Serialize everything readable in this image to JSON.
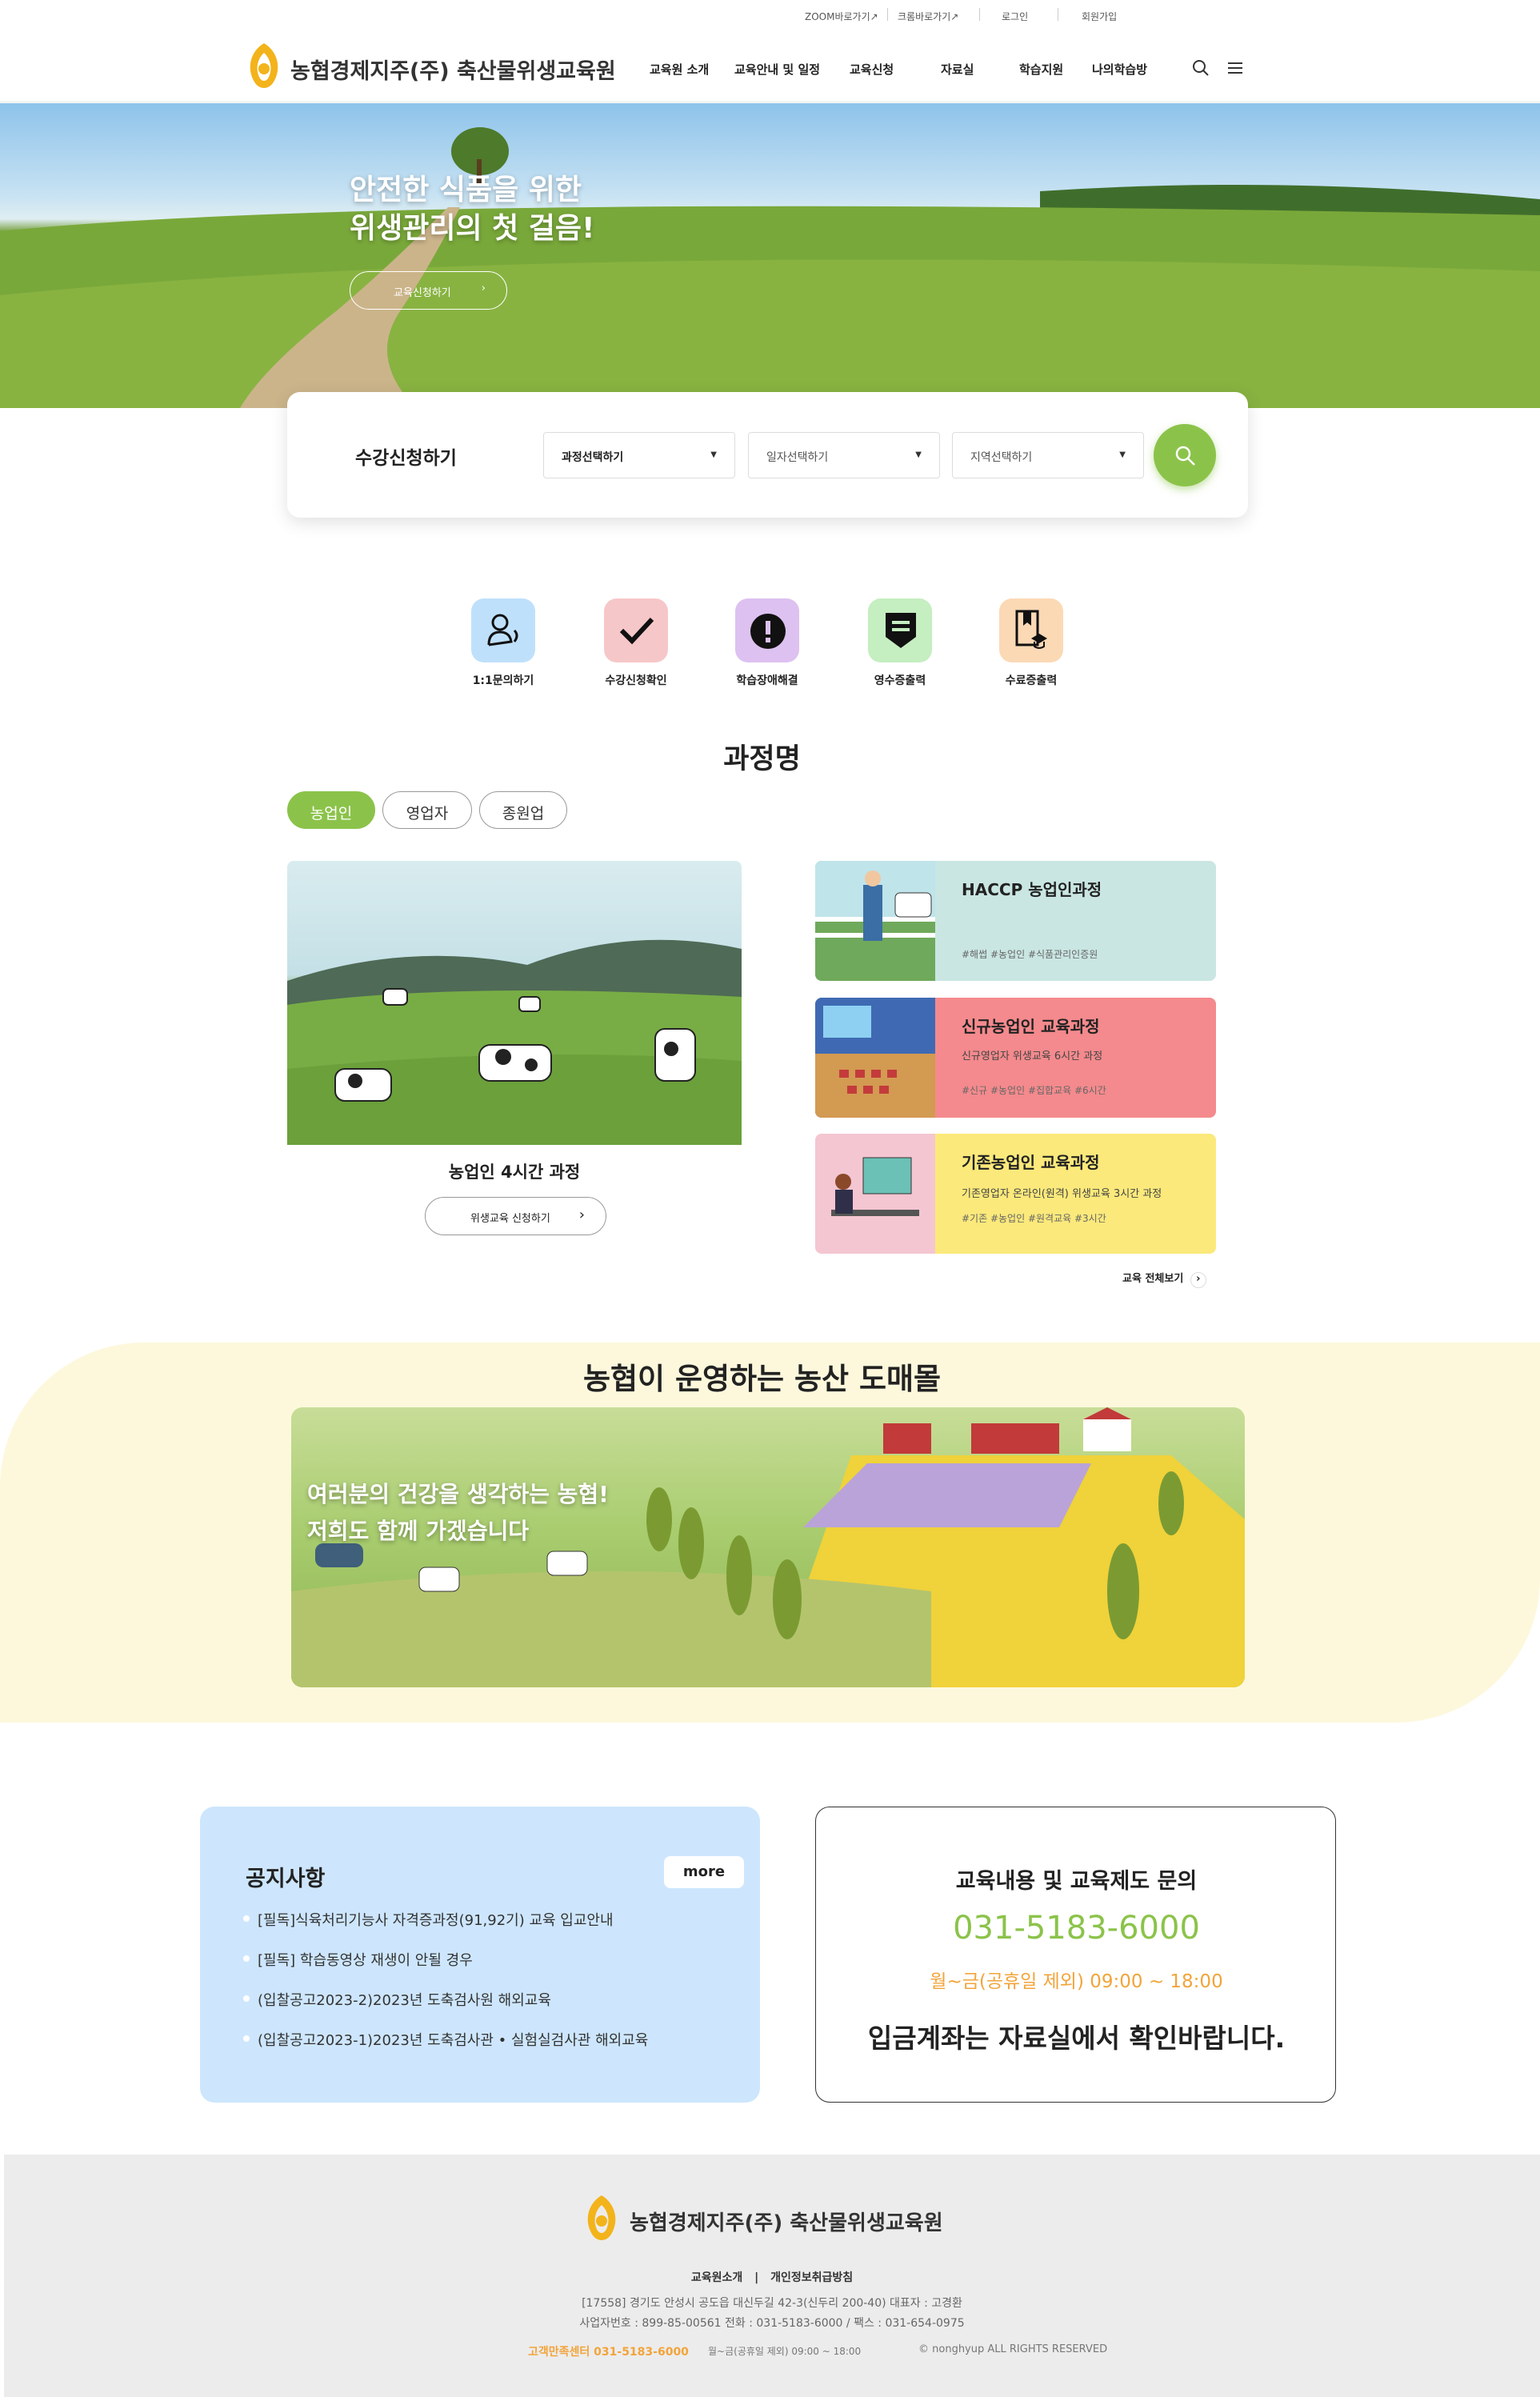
{
  "topbar": {
    "zoom": "ZOOM바로가기↗",
    "chrome": "크롬바로가기↗",
    "login": "로그인",
    "signup": "회원가입"
  },
  "header": {
    "logo_text": "농협경제지주(주) 축산물위생교육원",
    "nav": [
      "교육원 소개",
      "교육안내 및 일정",
      "교육신청",
      "자료실",
      "학습지원",
      "나의학습방"
    ]
  },
  "hero": {
    "line1": "안전한 식품을 위한",
    "line2": "위생관리의 첫 걸음!",
    "button": "교육신청하기"
  },
  "registration": {
    "title": "수강신청하기",
    "course_select": "과정선택하기",
    "date_select": "일자선택하기",
    "region_select": "지역선택하기"
  },
  "quick_links": [
    "1:1문의하기",
    "수강신청확인",
    "학습장애해결",
    "영수증출력",
    "수료증출력"
  ],
  "courses": {
    "section_title": "과정명",
    "tabs": [
      "농업인",
      "영업자",
      "종원업"
    ],
    "featured_title": "농업인 4시간 과정",
    "featured_button": "위생교육 신청하기",
    "cards": [
      {
        "title": "HACCP 농업인과정",
        "sub": "",
        "tags": "#해썹 #농업인 #식품관리인증원"
      },
      {
        "title": "신규농업인 교육과정",
        "sub": "신규영업자 위생교육 6시간 과정",
        "tags": "#신규 #농업인 #집합교육 #6시간"
      },
      {
        "title": "기존농업인 교육과정",
        "sub": "기존영업자 온라인(원격) 위생교육 3시간 과정",
        "tags": "#기존 #농업인 #원격교육 #3시간"
      }
    ],
    "view_all": "교육 전체보기"
  },
  "mall": {
    "title": "농협이 운영하는 농산 도매몰",
    "line1": "여러분의 건강을 생각하는 농협!",
    "line2": "저희도 함께 가겠습니다"
  },
  "notice": {
    "title": "공지사항",
    "more": "more",
    "items": [
      "[필독]식육처리기능사 자격증과정(91,92기) 교육 입교안내",
      "[필독] 학습동영상 재생이 안될 경우",
      "(입찰공고2023-2)2023년 도축검사원 해외교육",
      "(입찰공고2023-1)2023년 도축검사관 • 실험실검사관 해외교육"
    ]
  },
  "contact": {
    "title": "교육내용 및 교육제도 문의",
    "phone": "031-5183-6000",
    "hours": "월~금(공휴일 제외) 09:00 ~ 18:00",
    "account_note": "입금계좌는 자료실에서 확인바랍니다."
  },
  "footer": {
    "logo_text": "농협경제지주(주) 축산물위생교육원",
    "link1": "교육원소개",
    "link2": "개인정보취급방침",
    "address": "[17558] 경기도 안성시 공도읍 대신두길 42-3(신두리 200-40) 대표자 : 고경환",
    "biz": "사업자번호 : 899-85-00561  전화 : 031-5183-6000 / 팩스 : 031-654-0975",
    "cs": "고객만족센터 031-5183-6000",
    "cs_hours": "월~금(공휴일 제외) 09:00 ~ 18:00",
    "copyright": "© nonghyup ALL RIGHTS RESERVED"
  },
  "colors": {
    "green": "#8bc34a",
    "orange": "#f2a43a",
    "notice_bg": "#cde6fd",
    "mall_bg": "#fdf8dc"
  }
}
